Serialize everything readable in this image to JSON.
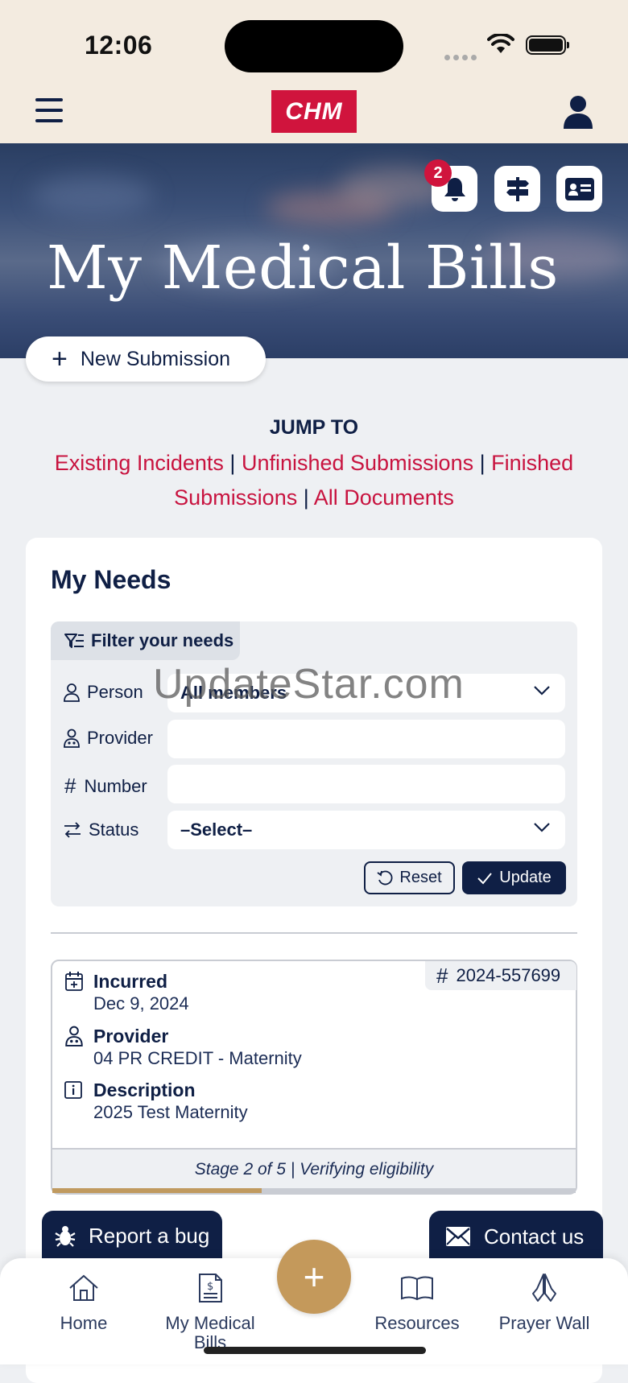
{
  "status_bar": {
    "time": "12:06"
  },
  "header": {
    "logo": "CHM"
  },
  "hero": {
    "title": "My Medical Bills",
    "notification_count": "2"
  },
  "new_submission": {
    "label": "New Submission"
  },
  "jump_to": {
    "title": "JUMP TO",
    "links": [
      "Existing Incidents",
      "Unfinished Submissions",
      "Finished Submissions",
      "All Documents"
    ],
    "separator": "|"
  },
  "needs": {
    "title": "My Needs",
    "filter": {
      "tab_label": "Filter your needs",
      "person_label": "Person",
      "person_value": "All members",
      "provider_label": "Provider",
      "provider_value": "",
      "number_label": "Number",
      "number_value": "",
      "status_label": "Status",
      "status_value": "–Select–",
      "reset_label": "Reset",
      "update_label": "Update"
    },
    "incident": {
      "number_symbol": "#",
      "number": "2024-557699",
      "incurred_label": "Incurred",
      "incurred_value": "Dec 9, 2024",
      "provider_label": "Provider",
      "provider_value": "04 PR CREDIT - Maternity",
      "description_label": "Description",
      "description_value": "2025 Test Maternity",
      "stage_text": "Stage 2 of 5 | Verifying eligibility",
      "progress_fraction": 0.4
    }
  },
  "floating": {
    "report_bug": "Report a bug",
    "contact_us": "Contact us"
  },
  "tabbar": {
    "home": "Home",
    "bills_line1": "My Medical",
    "bills_line2": "Bills",
    "fab_icon": "+",
    "resources": "Resources",
    "prayer": "Prayer Wall"
  },
  "watermark": "UpdateStar.com",
  "colors": {
    "navy": "#0f1f45",
    "brand_red": "#d0143d",
    "gold": "#c4995b",
    "link_red": "#c8133f"
  }
}
